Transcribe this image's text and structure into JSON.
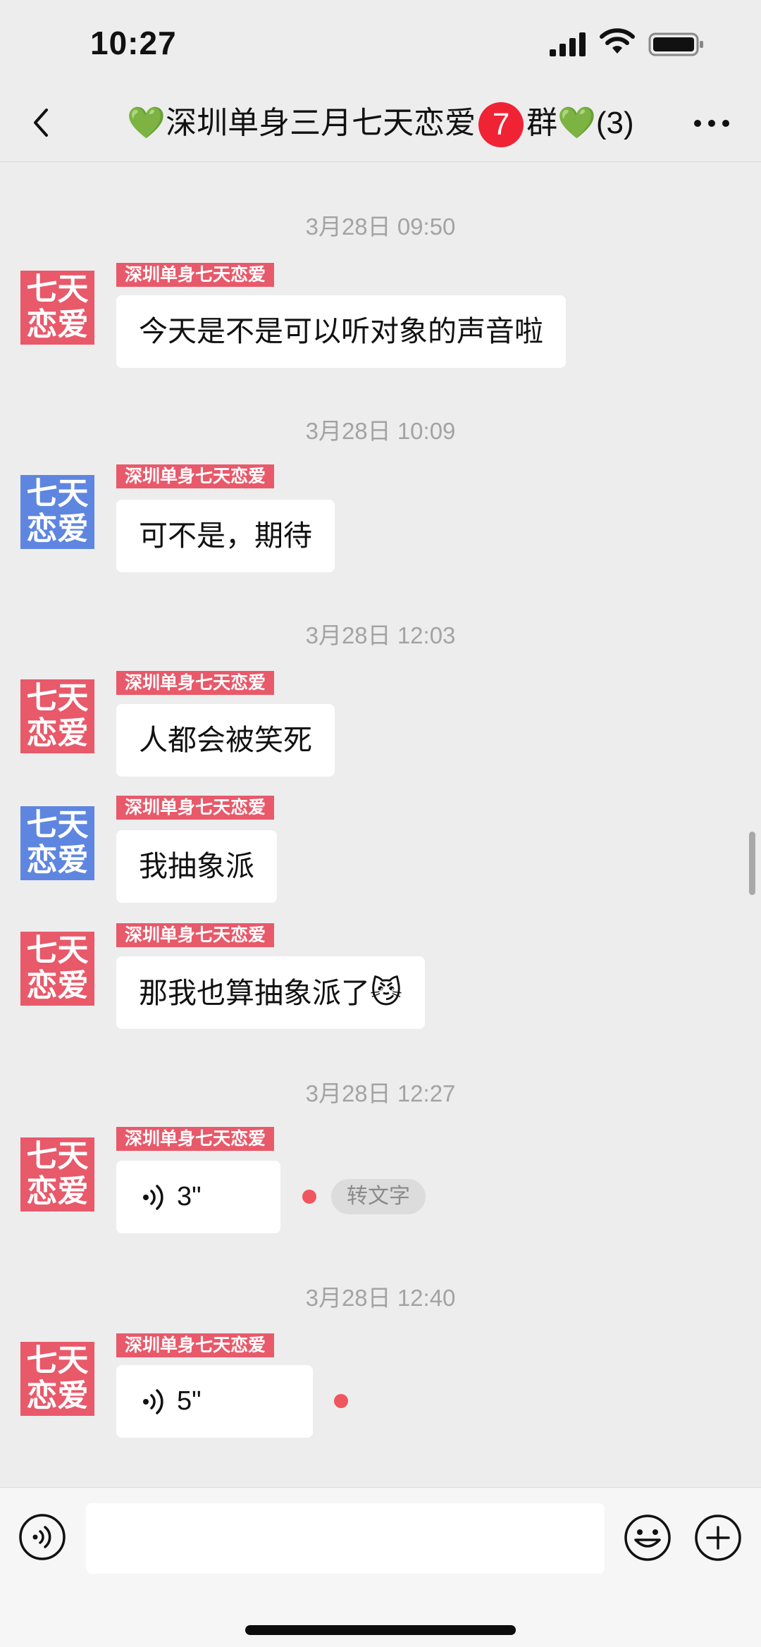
{
  "status": {
    "time": "10:27"
  },
  "nav": {
    "heart_left": "💚",
    "title_main": "深圳单身三月七天恋爱",
    "badge": "7",
    "title_suffix": "群",
    "heart_right": "💚",
    "member_count": "(3)"
  },
  "avatar_text": {
    "line1": "七天",
    "line2": "恋爱"
  },
  "sender_tag": "深圳单身七天恋爱",
  "colors": {
    "accent_red": "#e8596a",
    "accent_blue": "#5e86e0",
    "badge_red": "#f02334",
    "heart_green": "#2bbd4a"
  },
  "messages": {
    "ts1": "3月28日 09:50",
    "m1": "今天是不是可以听对象的声音啦",
    "ts2": "3月28日 10:09",
    "m2": "可不是，期待",
    "ts3": "3月28日 12:03",
    "m3": "人都会被笑死",
    "m4": "我抽象派",
    "m5": "那我也算抽象派了",
    "m5_emoji": "😼",
    "ts4": "3月28日 12:27",
    "voice1_duration": "3\"",
    "transcribe_label": "转文字",
    "ts5": "3月28日 12:40",
    "voice2_duration": "5\""
  },
  "input": {
    "placeholder": "",
    "value": ""
  },
  "icons": [
    "back-icon",
    "more-icon",
    "signal-icon",
    "wifi-icon",
    "battery-icon",
    "voice-wave-icon",
    "emoji-icon",
    "plus-icon"
  ]
}
